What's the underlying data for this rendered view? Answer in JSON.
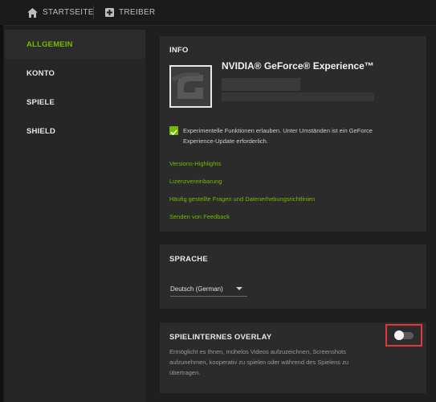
{
  "topbar": {
    "home_label": "STARTSEITE",
    "drivers_label": "TREIBER"
  },
  "sidebar": {
    "items": [
      {
        "label": "ALLGEMEIN",
        "active": true
      },
      {
        "label": "KONTO",
        "active": false
      },
      {
        "label": "SPIELE",
        "active": false
      },
      {
        "label": "SHIELD",
        "active": false
      }
    ]
  },
  "info": {
    "title": "INFO",
    "app_name": "NVIDIA® GeForce® Experience™",
    "experimental_checked": true,
    "experimental_text": "Experimentelle Funktionen erlauben. Unter Umständen ist ein GeForce Experience-Update erforderlich.",
    "links": [
      "Versions-Highlights",
      "Lizenzvereinbarung",
      "Häufig gestellte Fragen und Datenerhebungsrichtlinien",
      "Senden von Feedback"
    ]
  },
  "language": {
    "title": "SPRACHE",
    "selected": "Deutsch (German)"
  },
  "overlay": {
    "title": "SPIELINTERNES OVERLAY",
    "description": "Ermöglicht es Ihnen, mühelos Videos aufzuzeichnen, Screenshots aufzunehmen, kooperativ zu spielen oder während des Spielens zu übertragen.",
    "enabled": false
  },
  "colors": {
    "accent": "#76b900",
    "highlight_border": "#e0383e"
  }
}
